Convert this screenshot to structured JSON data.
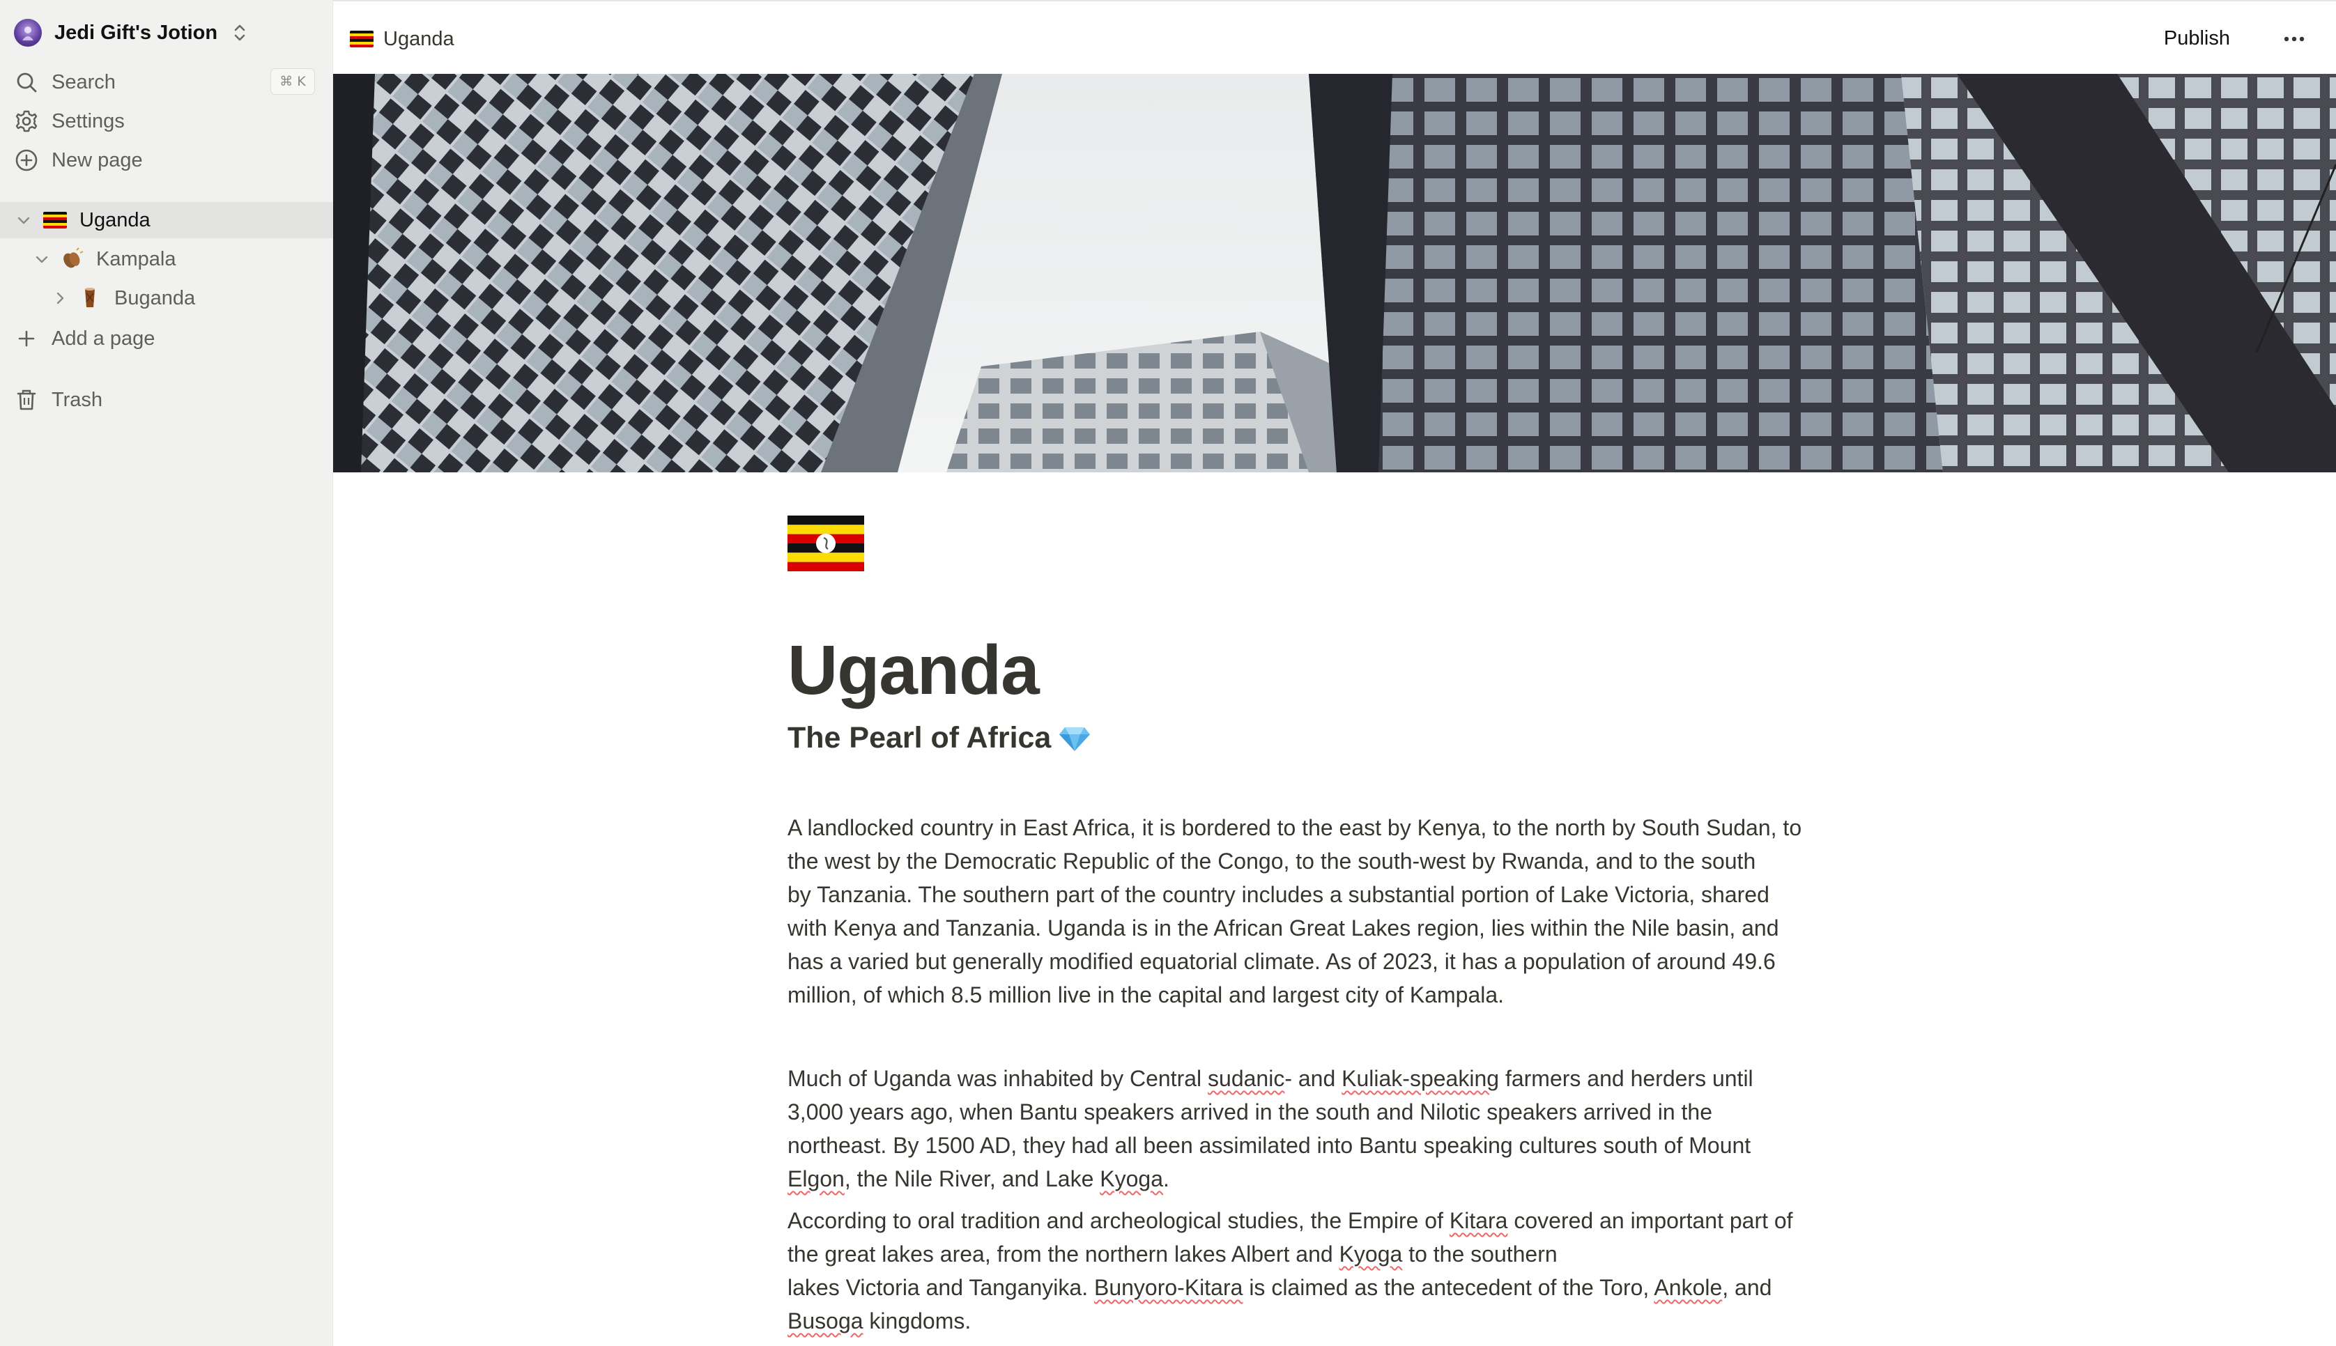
{
  "workspace": {
    "name": "Jedi Gift's Jotion"
  },
  "nav": {
    "search": "Search",
    "search_shortcut": "⌘ K",
    "settings": "Settings",
    "new_page": "New page"
  },
  "tree": {
    "items": [
      {
        "label": "Uganda",
        "emoji": "flag-uganda"
      },
      {
        "label": "Kampala",
        "emoji": "clapping-hands-icon"
      },
      {
        "label": "Buganda",
        "emoji": "drum-icon"
      }
    ],
    "add_page": "Add a page",
    "trash": "Trash"
  },
  "topbar": {
    "breadcrumb": "Uganda",
    "publish": "Publish"
  },
  "page": {
    "title": "Uganda",
    "subtitle": "The Pearl of Africa",
    "p1": {
      "l1": "A landlocked country in East Africa, it is bordered to the east by Kenya, to the north by South Sudan, to",
      "l2": "the west by the Democratic Republic of the Congo, to the south-west by Rwanda, and to the south",
      "l3": "by Tanzania. The southern part of the country includes a substantial portion of Lake Victoria, shared",
      "l4": "with Kenya and Tanzania. Uganda is in the African Great Lakes region, lies within the Nile basin, and",
      "l5": "has a varied but generally modified equatorial climate. As of 2023, it has a population of around 49.6",
      "l6": "million, of which 8.5 million live in the capital and largest city of Kampala."
    },
    "p2": {
      "a": "Much of Uganda was inhabited by Central ",
      "b": "sudanic",
      "c": "- and ",
      "d": "Kuliak-speaking",
      "e": " farmers and herders until",
      "l2": "3,000 years ago, when Bantu speakers arrived in the south and Nilotic speakers arrived in the",
      "l3": "northeast. By 1500 AD, they had all been assimilated into Bantu speaking cultures south of Mount",
      "f": "Elgon",
      "g": ", the Nile River, and Lake ",
      "h": "Kyoga",
      "i": "."
    },
    "p3": {
      "a": "According to oral tradition and archeological studies, the Empire of ",
      "b": "Kitara",
      "c": " covered an important part of",
      "d": "the great lakes area, from the northern lakes Albert and ",
      "e": "Kyoga",
      "f": " to the southern",
      "g": "lakes Victoria and Tanganyika. ",
      "h": "Bunyoro-Kitara",
      "i": " is claimed as the antecedent of the Toro, ",
      "j": "Ankole",
      "k": ", and",
      "l": "Busoga",
      "m": " kingdoms."
    }
  },
  "colors": {
    "sidebar_bg": "#f1f1f0",
    "text": "#37352f",
    "flag_black": "#111111",
    "flag_yellow": "#fcdc04",
    "flag_red": "#d90000"
  }
}
